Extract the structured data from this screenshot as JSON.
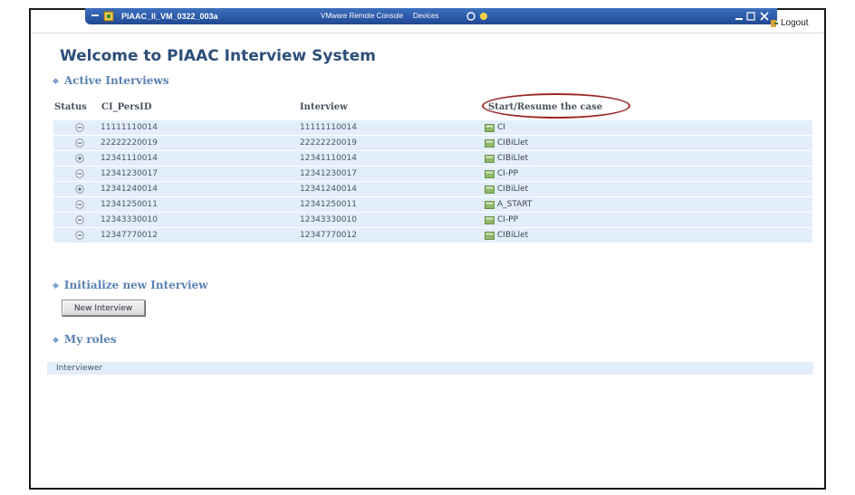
{
  "vm_bar": {
    "title": "PIAAC_II_VM_0322_003a",
    "menu_remote": "VMware Remote Console",
    "menu_devices": "Devices"
  },
  "header": {
    "logout_label": "Logout"
  },
  "page": {
    "title": "Welcome to PIAAC Interview System"
  },
  "sections": {
    "active_interviews": "Active Interviews",
    "init_new": "Initialize new Interview",
    "my_roles": "My roles"
  },
  "table": {
    "headers": {
      "status": "Status",
      "persid": "CI_PersID",
      "interview": "Interview",
      "case": "Start/Resume the case"
    },
    "rows": [
      {
        "persid": "11111110014",
        "interview": "11111110014",
        "case": "CI",
        "status": "minus"
      },
      {
        "persid": "22222220019",
        "interview": "22222220019",
        "case": "CIBiLlet",
        "status": "minus"
      },
      {
        "persid": "12341110014",
        "interview": "12341110014",
        "case": "CIBiLlet",
        "status": "plus"
      },
      {
        "persid": "12341230017",
        "interview": "12341230017",
        "case": "CI-PP",
        "status": "minus"
      },
      {
        "persid": "12341240014",
        "interview": "12341240014",
        "case": "CIBiLlet",
        "status": "plus"
      },
      {
        "persid": "12341250011",
        "interview": "12341250011",
        "case": "A_START",
        "status": "minus"
      },
      {
        "persid": "12343330010",
        "interview": "12343330010",
        "case": "CI-PP",
        "status": "minus"
      },
      {
        "persid": "12347770012",
        "interview": "12347770012",
        "case": "CIBiLlet",
        "status": "minus"
      }
    ]
  },
  "new_interview_button": "New Interview",
  "roles": [
    "Interviewer"
  ],
  "colors": {
    "title": "#2d4f79",
    "section": "#5b82b3",
    "row_bg": "#e3eefb",
    "annotation_oval": "#9b2a2a"
  }
}
